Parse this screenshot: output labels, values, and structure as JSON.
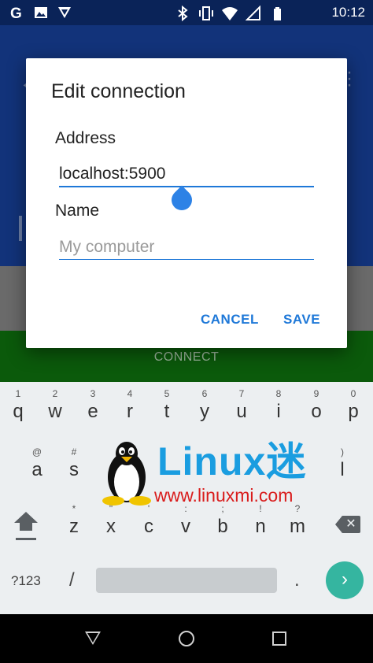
{
  "status_bar": {
    "time": "10:12",
    "left_icons": [
      "google-icon",
      "image-icon",
      "messages-icon"
    ],
    "right_icons": [
      "bluetooth-icon",
      "vibrate-icon",
      "wifi-icon",
      "signal-icon",
      "battery-icon"
    ]
  },
  "background": {
    "connect_label": "CONNECT"
  },
  "dialog": {
    "title": "Edit connection",
    "address_label": "Address",
    "address_value": "localhost:5900",
    "name_label": "Name",
    "name_placeholder": "My computer",
    "cancel_label": "CANCEL",
    "save_label": "SAVE"
  },
  "keyboard": {
    "row1": [
      {
        "ch": "q",
        "hint": "1"
      },
      {
        "ch": "w",
        "hint": "2"
      },
      {
        "ch": "e",
        "hint": "3"
      },
      {
        "ch": "r",
        "hint": "4"
      },
      {
        "ch": "t",
        "hint": "5"
      },
      {
        "ch": "y",
        "hint": "6"
      },
      {
        "ch": "u",
        "hint": "7"
      },
      {
        "ch": "i",
        "hint": "8"
      },
      {
        "ch": "o",
        "hint": "9"
      },
      {
        "ch": "p",
        "hint": "0"
      }
    ],
    "row2": [
      {
        "ch": "a",
        "hint": "@"
      },
      {
        "ch": "s",
        "hint": "#"
      },
      {
        "ch": "l",
        "hint": ")"
      }
    ],
    "row3": [
      {
        "ch": "z",
        "hint": "*"
      },
      {
        "ch": "x",
        "hint": "\""
      },
      {
        "ch": "c",
        "hint": "'"
      },
      {
        "ch": "v",
        "hint": ":"
      },
      {
        "ch": "b",
        "hint": ";"
      },
      {
        "ch": "n",
        "hint": "!"
      },
      {
        "ch": "m",
        "hint": "?"
      }
    ],
    "symbols_label": "?123",
    "slash_label": "/",
    "period_label": ".",
    "go_label": "›"
  },
  "watermark": {
    "title": "Linux迷",
    "url": "www.linuxmi.com"
  },
  "colors": {
    "accent": "#1e78d8",
    "app_bar": "#12337a",
    "connect_band": "#0b5a0b",
    "go_button": "#35b5a0"
  }
}
